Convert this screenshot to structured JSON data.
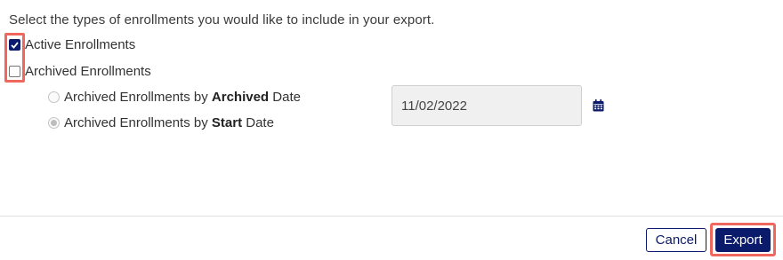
{
  "form": {
    "intro": "Select the types of enrollments you would like to include in your export.",
    "active_label": "Active Enrollments",
    "active_checked": true,
    "archived_label": "Archived Enrollments",
    "archived_checked": false
  },
  "options": {
    "by_archived": {
      "prefix": "Archived Enrollments by ",
      "emphasis": "Archived",
      "suffix": " Date",
      "selected": false
    },
    "by_start": {
      "prefix": "Archived Enrollments by ",
      "emphasis": "Start",
      "suffix": " Date",
      "selected": true
    }
  },
  "date": {
    "value": "11/02/2022"
  },
  "icons": {
    "calendar": "calendar-icon"
  },
  "footer": {
    "cancel_label": "Cancel",
    "export_label": "Export"
  },
  "colors": {
    "primary": "#0b1b6b",
    "highlight": "#f0685d"
  }
}
